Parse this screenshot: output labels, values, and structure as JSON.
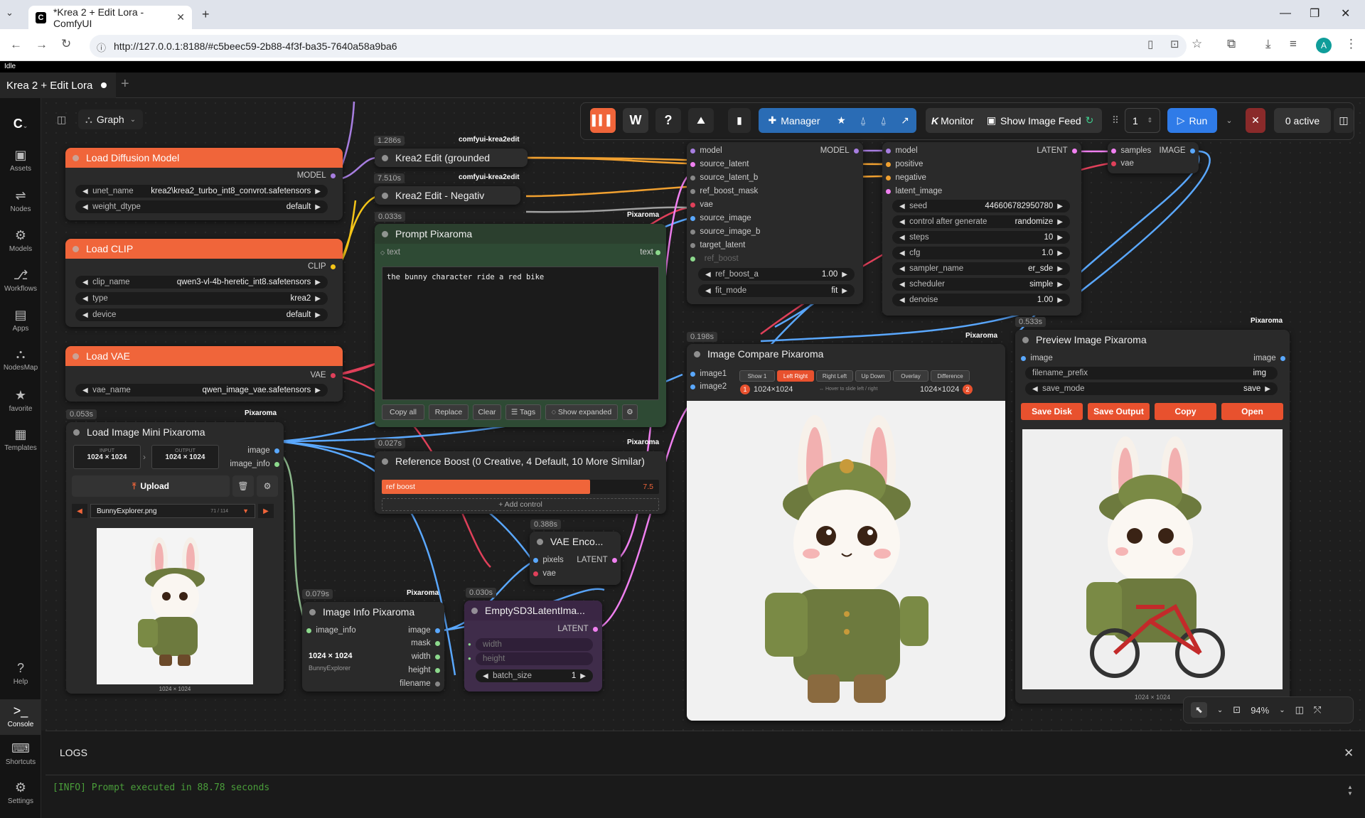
{
  "browser": {
    "tab_title": "*Krea 2 + Edit Lora - ComfyUI",
    "url": "http://127.0.0.1:8188/#c5beec59-2b88-4f3f-ba35-7640a58a9ba6",
    "profile_initial": "A"
  },
  "app": {
    "status": "Idle",
    "workflow_tab": "Krea 2 + Edit Lora",
    "graph_label": "Graph",
    "sidebar": [
      {
        "label": "Assets",
        "icon": "assets-icon"
      },
      {
        "label": "Nodes",
        "icon": "nodes-icon"
      },
      {
        "label": "Models",
        "icon": "models-icon"
      },
      {
        "label": "Workflows",
        "icon": "workflows-icon"
      },
      {
        "label": "Apps",
        "icon": "apps-icon"
      },
      {
        "label": "NodesMap",
        "icon": "nodesmap-icon"
      },
      {
        "label": "favorite",
        "icon": "star-icon"
      },
      {
        "label": "Templates",
        "icon": "templates-icon"
      },
      {
        "label": "Help",
        "icon": "help-icon"
      },
      {
        "label": "Console",
        "icon": "console-icon"
      },
      {
        "label": "Shortcuts",
        "icon": "keyboard-icon"
      },
      {
        "label": "Settings",
        "icon": "gear-icon"
      }
    ]
  },
  "toolbar": {
    "manager": "Manager",
    "monitor": "Monitor",
    "show_image_feed": "Show Image Feed",
    "queue_count": "1",
    "run": "Run",
    "active": "0 active"
  },
  "nodes": {
    "load_diffusion": {
      "title": "Load Diffusion Model",
      "out": "MODEL",
      "unet_name_label": "unet_name",
      "unet_name": "krea2\\krea2_turbo_int8_convrot.safetensors",
      "weight_dtype_label": "weight_dtype",
      "weight_dtype": "default"
    },
    "load_clip": {
      "title": "Load CLIP",
      "out": "CLIP",
      "clip_name_label": "clip_name",
      "clip_name": "qwen3-vl-4b-heretic_int8.safetensors",
      "type_label": "type",
      "type": "krea2",
      "device_label": "device",
      "device": "default"
    },
    "load_vae": {
      "title": "Load VAE",
      "out": "VAE",
      "vae_name_label": "vae_name",
      "vae_name": "qwen_image_vae.safetensors"
    },
    "krea2_grounded": {
      "time": "1.286s",
      "badge": "comfyui-krea2edit",
      "title": "Krea2 Edit (grounded"
    },
    "krea2_neg": {
      "time": "7.510s",
      "badge": "comfyui-krea2edit",
      "title": "Krea2 Edit - Negativ"
    },
    "prompt": {
      "time": "0.033s",
      "badge": "Pixaroma",
      "title": "Prompt Pixaroma",
      "in": "text",
      "out": "text",
      "text": "the bunny character ride a red bike",
      "buttons": [
        "Copy all",
        "Replace",
        "Clear",
        "☰ Tags",
        "◌ Show expanded"
      ]
    },
    "ref_boost": {
      "time": "0.027s",
      "badge": "Pixaroma",
      "title": "Reference Boost (0 Creative, 4 Default, 10 More Similar)",
      "slider_label": "ref boost",
      "slider_value": "7.5",
      "slider_fraction": 0.75,
      "add_control": "+ Add control"
    },
    "load_image": {
      "time": "0.053s",
      "badge": "Pixaroma",
      "title": "Load Image Mini Pixaroma",
      "out1": "image",
      "out2": "image_info",
      "input_label": "INPUT",
      "input_size": "1024 × 1024",
      "output_label": "OUTPUT",
      "output_size": "1024 × 1024",
      "upload": "Upload",
      "file": "BunnyExplorer.png",
      "file_index": "71 / 114",
      "caption": "1024 × 1024"
    },
    "image_info": {
      "time": "0.079s",
      "badge": "Pixaroma",
      "title": "Image Info Pixaroma",
      "in": "image_info",
      "outs": [
        "image",
        "mask",
        "width",
        "height",
        "filename"
      ],
      "size": "1024 × 1024",
      "name": "BunnyExplorer"
    },
    "empty_latent": {
      "time": "0.030s",
      "title": "EmptySD3LatentIma...",
      "out": "LATENT",
      "width": "width",
      "height": "height",
      "batch_label": "batch_size",
      "batch": "1"
    },
    "vae_encode": {
      "time": "0.388s",
      "title": "VAE Enco...",
      "in1": "pixels",
      "in2": "vae",
      "out": "LATENT"
    },
    "edit_cond": {
      "ins": [
        "model",
        "source_latent",
        "source_latent_b",
        "ref_boost_mask",
        "vae",
        "source_image",
        "source_image_b",
        "target_latent",
        "ref_boost"
      ],
      "out": "MODEL",
      "ref_boost_a_label": "ref_boost_a",
      "ref_boost_a": "1.00",
      "fit_mode_label": "fit_mode",
      "fit_mode": "fit"
    },
    "ksampler": {
      "ins": [
        "model",
        "positive",
        "negative",
        "latent_image"
      ],
      "out": "LATENT",
      "seed_label": "seed",
      "seed": "446606782950780",
      "cag_label": "control after generate",
      "cag": "randomize",
      "steps_label": "steps",
      "steps": "10",
      "cfg_label": "cfg",
      "cfg": "1.0",
      "sampler_label": "sampler_name",
      "sampler": "er_sde",
      "scheduler_label": "scheduler",
      "scheduler": "simple",
      "denoise_label": "denoise",
      "denoise": "1.00"
    },
    "vae_decode": {
      "ins": [
        "samples",
        "vae"
      ],
      "out": "IMAGE"
    },
    "compare": {
      "time": "0.198s",
      "badge": "Pixaroma",
      "title": "Image Compare Pixaroma",
      "in1": "image1",
      "in2": "image2",
      "modes": [
        "Show 1",
        "Left Right",
        "Right Left",
        "Up Down",
        "Overlay",
        "Difference"
      ],
      "size1": "1024×1024",
      "size2": "1024×1024",
      "hint": "↔ Hover to slide left / right",
      "badge1": "1",
      "badge2": "2"
    },
    "preview": {
      "time": "0.533s",
      "badge": "Pixaroma",
      "title": "Preview Image Pixaroma",
      "in": "image",
      "out": "image",
      "prefix_label": "filename_prefix",
      "prefix": "img",
      "save_mode_label": "save_mode",
      "save_mode": "save",
      "buttons": [
        "Save Disk",
        "Save Output",
        "Copy",
        "Open"
      ],
      "caption": "1024 × 1024"
    }
  },
  "zoom": "94%",
  "logs": {
    "title": "LOGS",
    "line": "[INFO] Prompt executed in 88.78 seconds"
  }
}
